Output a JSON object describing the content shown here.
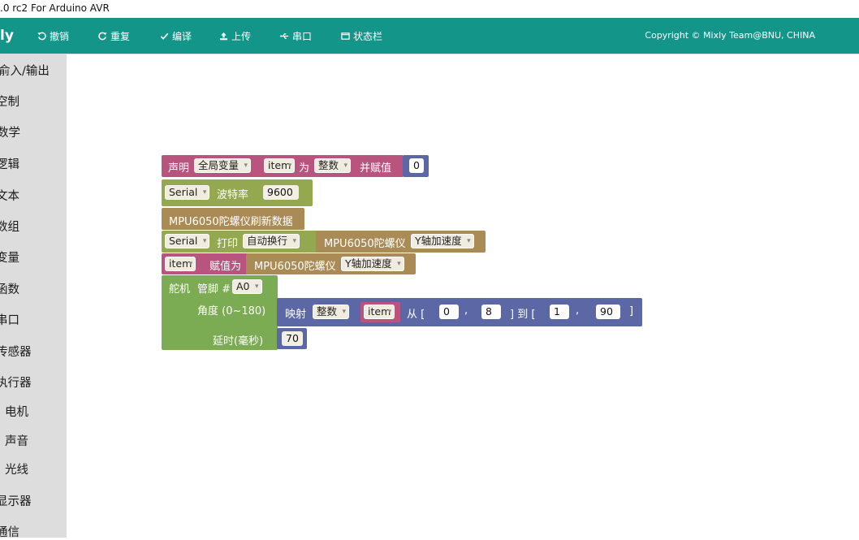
{
  "window": {
    "title": ".0 rc2 For Arduino AVR"
  },
  "toolbar": {
    "logo": "ly",
    "undo": "撤销",
    "redo": "重复",
    "compile": "编译",
    "upload": "上传",
    "serial": "串口",
    "statusbar": "状态栏",
    "copyright": "Copyright © Mixly Team@BNU, CHINA"
  },
  "sidebar": {
    "items": [
      "俞入/输出",
      "空制",
      "数学",
      "逻辑",
      "文本",
      "数组",
      "变量",
      "函数",
      "串口",
      "传感器",
      "执行器",
      "电机",
      "声音",
      "光线",
      "显示器",
      "通信"
    ]
  },
  "blocks": {
    "declare": {
      "prefix": "声明",
      "scope": "全局变量",
      "name": "item",
      "as": "为",
      "type": "整数",
      "assign": "并赋值",
      "value": "0"
    },
    "serial_begin": {
      "port": "Serial",
      "label": "波特率",
      "baud": "9600"
    },
    "mpu_update": {
      "label": "MPU6050陀螺仪刷新数据"
    },
    "serial_print": {
      "port": "Serial",
      "label": "打印",
      "mode": "自动换行",
      "sensor": "MPU6050陀螺仪",
      "axis": "Y轴加速度"
    },
    "assign_item": {
      "var": "item",
      "label": "赋值为",
      "sensor": "MPU6050陀螺仪",
      "axis": "Y轴加速度"
    },
    "servo": {
      "label": "舵机",
      "pin_label": "管脚 #",
      "pin": "A0",
      "angle_label": "角度 (0~180)",
      "delay_label": "延时(毫秒)",
      "delay": "70"
    },
    "map": {
      "label": "映射",
      "type": "整数",
      "var": "item",
      "from": "从 [",
      "from_low": "0",
      "from_high": "8",
      "close_to": "] 到 [",
      "to_low": "1",
      "to_high": "90",
      "close": "]",
      "comma1": ",",
      "comma2": ","
    }
  },
  "colors": {
    "toolbar": "#13958a",
    "variables": "#b8547d",
    "serial": "#93a84f",
    "sensor": "#ab8b55",
    "servo": "#7bab52",
    "math": "#5c68a6"
  }
}
